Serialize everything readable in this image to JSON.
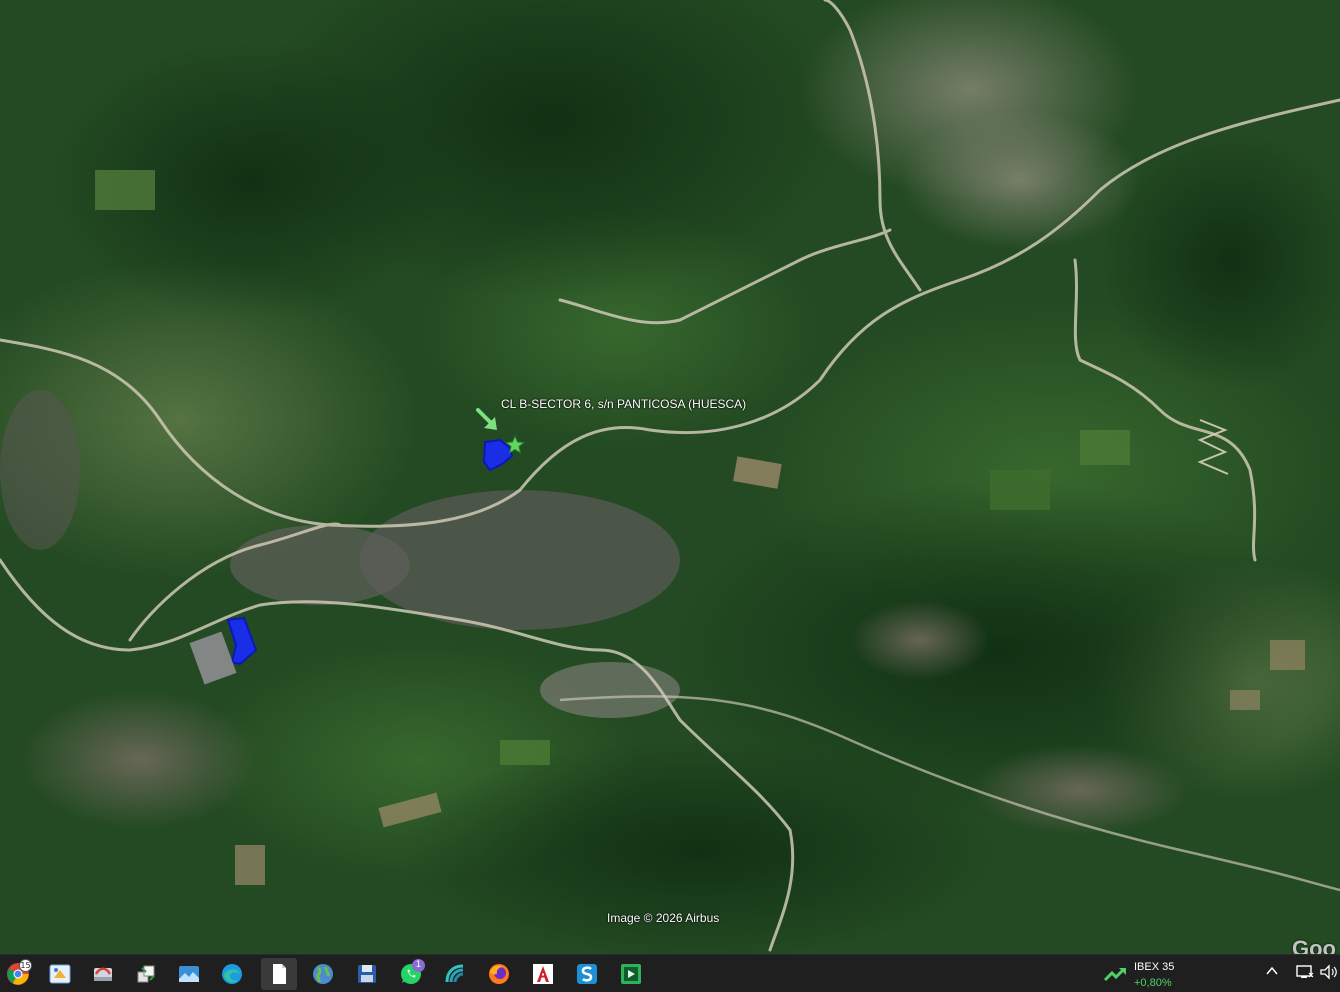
{
  "map": {
    "place_label": "CL B-SECTOR 6, s/n PANTICOSA (HUESCA)",
    "attribution": "Image © 2026 Airbus",
    "logo": "Goo",
    "colors": {
      "parcel": "#1a2ee6",
      "marker": "#7ee07e",
      "road": "#c9c3b0",
      "forest": "#1e4a1f"
    }
  },
  "taskbar": {
    "apps": [
      {
        "name": "chrome-icon",
        "badge": "15"
      },
      {
        "name": "paint-icon"
      },
      {
        "name": "screenshot-icon"
      },
      {
        "name": "file-transfer-icon"
      },
      {
        "name": "photos-icon"
      },
      {
        "name": "edge-icon"
      },
      {
        "name": "document-icon"
      },
      {
        "name": "globe-icon"
      },
      {
        "name": "save-disk-icon"
      },
      {
        "name": "whatsapp-icon",
        "badge": "1"
      },
      {
        "name": "satellite-dish-icon"
      },
      {
        "name": "firefox-icon"
      },
      {
        "name": "autocad-icon"
      },
      {
        "name": "s-app-icon"
      },
      {
        "name": "media-player-icon"
      }
    ],
    "ticker": {
      "name": "IBEX 35",
      "change": "+0,80%"
    },
    "tray": [
      "chevron-up-icon",
      "network-icon",
      "volume-icon"
    ]
  }
}
